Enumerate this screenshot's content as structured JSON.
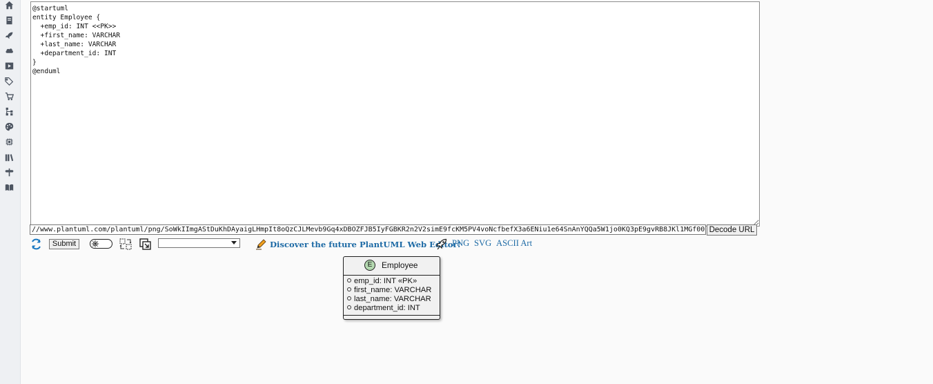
{
  "sidebar": {
    "items": [
      {
        "icon": "home-icon"
      },
      {
        "icon": "book-icon"
      },
      {
        "icon": "rocket-icon"
      },
      {
        "icon": "cloud-icon"
      },
      {
        "icon": "play-icon"
      },
      {
        "icon": "tags-icon"
      },
      {
        "icon": "cart-icon"
      },
      {
        "icon": "sitemap-icon"
      },
      {
        "icon": "palette-icon"
      },
      {
        "icon": "chip-icon"
      },
      {
        "icon": "library-icon"
      },
      {
        "icon": "signpost-icon"
      },
      {
        "icon": "open-book-icon"
      }
    ]
  },
  "editor": {
    "code": "@startuml\nentity Employee {\n  +emp_id: INT <<PK>>\n  +first_name: VARCHAR\n  +last_name: VARCHAR\n  +department_id: INT\n}\n@enduml"
  },
  "url_bar": {
    "value": "//www.plantuml.com/plantuml/png/SoWkIImgAStDuKhDAyaigLHmpIt8oQzCJLMevb9Gq4xDBOZFJB5IyFGBKR2n2V2simE9fcKM5PV4voNcfbefX3a6ENiu1e64SnAnYQQa5W1jo0KQ3pE9gvRB8JKl1MGf0000",
    "decode_label": "Decode URL"
  },
  "toolbar": {
    "submit_label": "Submit",
    "select_value": "",
    "discover_label": "Discover the future PlantUML Web Editor!",
    "png_label": "PNG",
    "svg_label": "SVG",
    "ascii_label": "ASCII Art"
  },
  "diagram": {
    "entity_badge": "E",
    "entity_name": "Employee",
    "attributes": [
      "emp_id: INT «PK»",
      "first_name: VARCHAR",
      "last_name: VARCHAR",
      "department_id: INT"
    ],
    "badge_color": "#b4d9b0"
  },
  "colors": {
    "link": "#1d6aa5",
    "refresh_icon": "#1a78c2"
  }
}
